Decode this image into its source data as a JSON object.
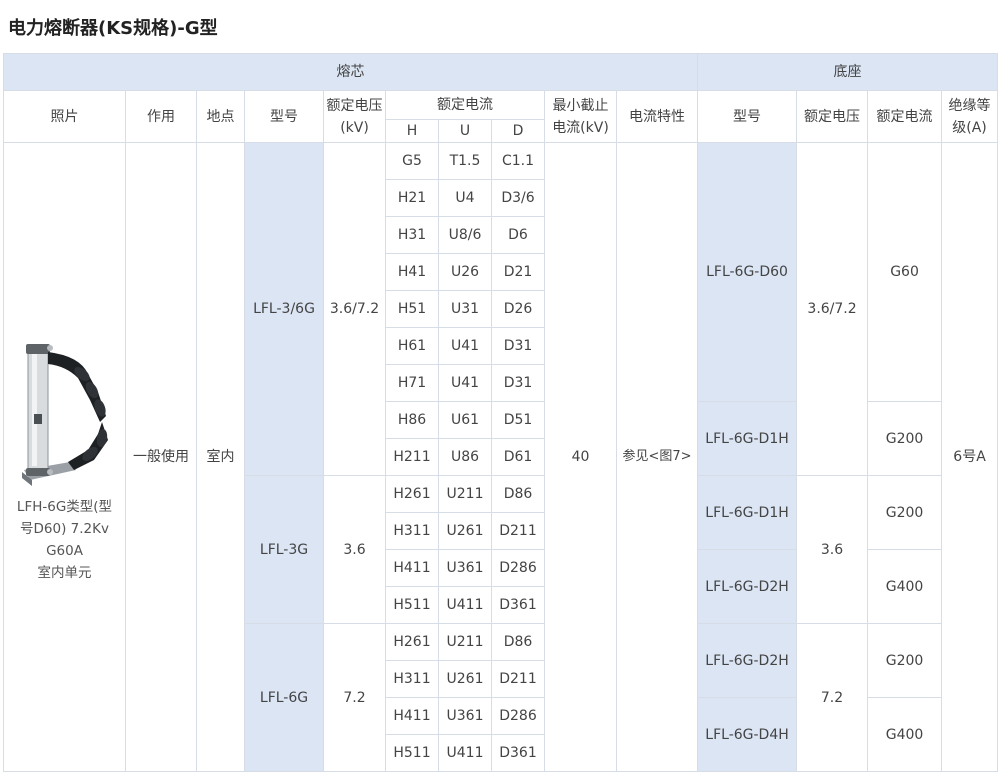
{
  "page_title": "电力熔断器(KS规格)-G型",
  "group_headers": {
    "fuse": "熔芯",
    "base": "底座"
  },
  "headers": {
    "photo": "照片",
    "use": "作用",
    "location": "地点",
    "fuse_model": "型号",
    "fuse_voltage": "额定电压(kV)",
    "fuse_current": "额定电流",
    "current_h": "H",
    "current_u": "U",
    "current_d": "D",
    "min_break": "最小截止电流(kV)",
    "characteristic": "电流特性",
    "base_model": "型号",
    "base_voltage": "额定电压",
    "base_current": "额定电流",
    "insulation": "绝缘等级(A)"
  },
  "photo": {
    "caption_lines": [
      "LFH-6G类型(型",
      "号D60) 7.2Kv",
      "G60A",
      "室内单元"
    ]
  },
  "common": {
    "use": "一般使用",
    "location": "室内",
    "min_break": "40",
    "characteristic": "参见<图7>",
    "insulation": "6号A"
  },
  "fuse_groups": [
    {
      "model": "LFL-3/6G",
      "voltage": "3.6/7.2"
    },
    {
      "model": "LFL-3G",
      "voltage": "3.6"
    },
    {
      "model": "LFL-6G",
      "voltage": "7.2"
    }
  ],
  "current_rows": [
    [
      "G5",
      "T1.5",
      "C1.1"
    ],
    [
      "H21",
      "U4",
      "D3/6"
    ],
    [
      "H31",
      "U8/6",
      "D6"
    ],
    [
      "H41",
      "U26",
      "D21"
    ],
    [
      "H51",
      "U31",
      "D26"
    ],
    [
      "H61",
      "U41",
      "D31"
    ],
    [
      "H71",
      "U41",
      "D31"
    ],
    [
      "H86",
      "U61",
      "D51"
    ],
    [
      "H211",
      "U86",
      "D61"
    ],
    [
      "H261",
      "U211",
      "D86"
    ],
    [
      "H311",
      "U261",
      "D211"
    ],
    [
      "H411",
      "U361",
      "D286"
    ],
    [
      "H511",
      "U411",
      "D361"
    ],
    [
      "H261",
      "U211",
      "D86"
    ],
    [
      "H311",
      "U261",
      "D211"
    ],
    [
      "H411",
      "U361",
      "D286"
    ],
    [
      "H511",
      "U411",
      "D361"
    ]
  ],
  "base_models": [
    "LFL-6G-D60",
    "LFL-6G-D1H",
    "LFL-6G-D1H",
    "LFL-6G-D2H",
    "LFL-6G-D2H",
    "LFL-6G-D4H"
  ],
  "base_voltages": [
    "3.6/7.2",
    "3.6",
    "7.2"
  ],
  "base_currents": [
    "G60",
    "G200",
    "G200",
    "G400",
    "G200",
    "G400"
  ],
  "colors": {
    "header_blue": "#dbe5f4",
    "border": "#d7dde6"
  }
}
